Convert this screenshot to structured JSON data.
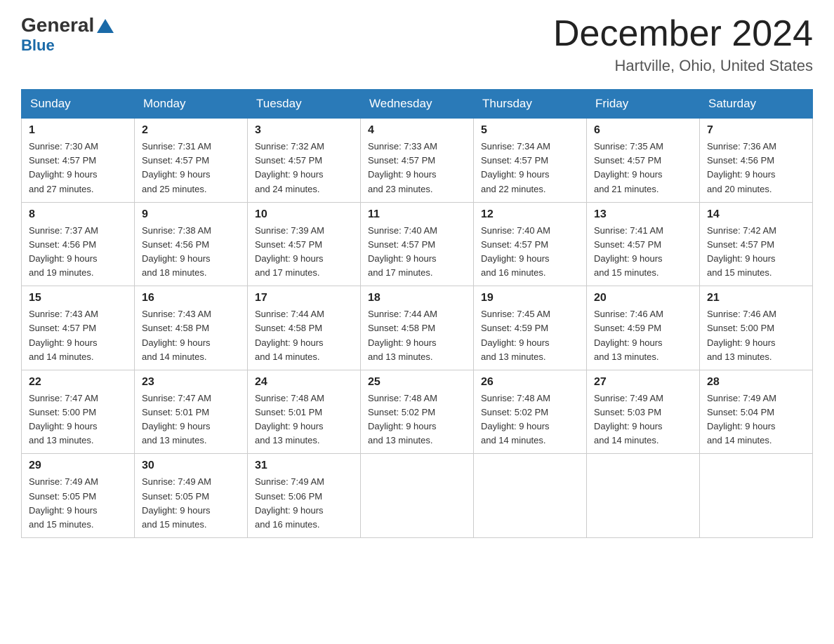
{
  "logo": {
    "general": "General",
    "blue": "Blue"
  },
  "title": {
    "month_year": "December 2024",
    "location": "Hartville, Ohio, United States"
  },
  "headers": [
    "Sunday",
    "Monday",
    "Tuesday",
    "Wednesday",
    "Thursday",
    "Friday",
    "Saturday"
  ],
  "weeks": [
    [
      {
        "day": "1",
        "sunrise": "7:30 AM",
        "sunset": "4:57 PM",
        "daylight": "9 hours and 27 minutes."
      },
      {
        "day": "2",
        "sunrise": "7:31 AM",
        "sunset": "4:57 PM",
        "daylight": "9 hours and 25 minutes."
      },
      {
        "day": "3",
        "sunrise": "7:32 AM",
        "sunset": "4:57 PM",
        "daylight": "9 hours and 24 minutes."
      },
      {
        "day": "4",
        "sunrise": "7:33 AM",
        "sunset": "4:57 PM",
        "daylight": "9 hours and 23 minutes."
      },
      {
        "day": "5",
        "sunrise": "7:34 AM",
        "sunset": "4:57 PM",
        "daylight": "9 hours and 22 minutes."
      },
      {
        "day": "6",
        "sunrise": "7:35 AM",
        "sunset": "4:57 PM",
        "daylight": "9 hours and 21 minutes."
      },
      {
        "day": "7",
        "sunrise": "7:36 AM",
        "sunset": "4:56 PM",
        "daylight": "9 hours and 20 minutes."
      }
    ],
    [
      {
        "day": "8",
        "sunrise": "7:37 AM",
        "sunset": "4:56 PM",
        "daylight": "9 hours and 19 minutes."
      },
      {
        "day": "9",
        "sunrise": "7:38 AM",
        "sunset": "4:56 PM",
        "daylight": "9 hours and 18 minutes."
      },
      {
        "day": "10",
        "sunrise": "7:39 AM",
        "sunset": "4:57 PM",
        "daylight": "9 hours and 17 minutes."
      },
      {
        "day": "11",
        "sunrise": "7:40 AM",
        "sunset": "4:57 PM",
        "daylight": "9 hours and 17 minutes."
      },
      {
        "day": "12",
        "sunrise": "7:40 AM",
        "sunset": "4:57 PM",
        "daylight": "9 hours and 16 minutes."
      },
      {
        "day": "13",
        "sunrise": "7:41 AM",
        "sunset": "4:57 PM",
        "daylight": "9 hours and 15 minutes."
      },
      {
        "day": "14",
        "sunrise": "7:42 AM",
        "sunset": "4:57 PM",
        "daylight": "9 hours and 15 minutes."
      }
    ],
    [
      {
        "day": "15",
        "sunrise": "7:43 AM",
        "sunset": "4:57 PM",
        "daylight": "9 hours and 14 minutes."
      },
      {
        "day": "16",
        "sunrise": "7:43 AM",
        "sunset": "4:58 PM",
        "daylight": "9 hours and 14 minutes."
      },
      {
        "day": "17",
        "sunrise": "7:44 AM",
        "sunset": "4:58 PM",
        "daylight": "9 hours and 14 minutes."
      },
      {
        "day": "18",
        "sunrise": "7:44 AM",
        "sunset": "4:58 PM",
        "daylight": "9 hours and 13 minutes."
      },
      {
        "day": "19",
        "sunrise": "7:45 AM",
        "sunset": "4:59 PM",
        "daylight": "9 hours and 13 minutes."
      },
      {
        "day": "20",
        "sunrise": "7:46 AM",
        "sunset": "4:59 PM",
        "daylight": "9 hours and 13 minutes."
      },
      {
        "day": "21",
        "sunrise": "7:46 AM",
        "sunset": "5:00 PM",
        "daylight": "9 hours and 13 minutes."
      }
    ],
    [
      {
        "day": "22",
        "sunrise": "7:47 AM",
        "sunset": "5:00 PM",
        "daylight": "9 hours and 13 minutes."
      },
      {
        "day": "23",
        "sunrise": "7:47 AM",
        "sunset": "5:01 PM",
        "daylight": "9 hours and 13 minutes."
      },
      {
        "day": "24",
        "sunrise": "7:48 AM",
        "sunset": "5:01 PM",
        "daylight": "9 hours and 13 minutes."
      },
      {
        "day": "25",
        "sunrise": "7:48 AM",
        "sunset": "5:02 PM",
        "daylight": "9 hours and 13 minutes."
      },
      {
        "day": "26",
        "sunrise": "7:48 AM",
        "sunset": "5:02 PM",
        "daylight": "9 hours and 14 minutes."
      },
      {
        "day": "27",
        "sunrise": "7:49 AM",
        "sunset": "5:03 PM",
        "daylight": "9 hours and 14 minutes."
      },
      {
        "day": "28",
        "sunrise": "7:49 AM",
        "sunset": "5:04 PM",
        "daylight": "9 hours and 14 minutes."
      }
    ],
    [
      {
        "day": "29",
        "sunrise": "7:49 AM",
        "sunset": "5:05 PM",
        "daylight": "9 hours and 15 minutes."
      },
      {
        "day": "30",
        "sunrise": "7:49 AM",
        "sunset": "5:05 PM",
        "daylight": "9 hours and 15 minutes."
      },
      {
        "day": "31",
        "sunrise": "7:49 AM",
        "sunset": "5:06 PM",
        "daylight": "9 hours and 16 minutes."
      },
      null,
      null,
      null,
      null
    ]
  ]
}
